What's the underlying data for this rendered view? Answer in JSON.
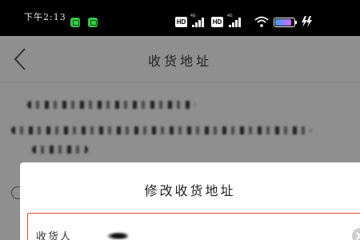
{
  "status_bar": {
    "time": "下午2:13",
    "hd_label_1": "HD",
    "hd_label_2": "HD",
    "net_label_1": "4G",
    "net_label_2": "4G",
    "battery_level": 0.85,
    "icons": [
      "message-icon",
      "message-icon",
      "signal-icon",
      "signal-icon",
      "wifi-icon",
      "battery-icon",
      "charging-icon"
    ]
  },
  "header": {
    "title": "收货地址",
    "back_icon": "chevron-left-icon"
  },
  "modal": {
    "title": "修改收货地址",
    "recipient_label": "收货人",
    "clear_icon": "close-circle-icon"
  },
  "colors": {
    "overlay": "#8f8f8f",
    "status_bar": "#000000",
    "field_border_active": "#e0473a",
    "modal_bg": "#ffffff"
  }
}
